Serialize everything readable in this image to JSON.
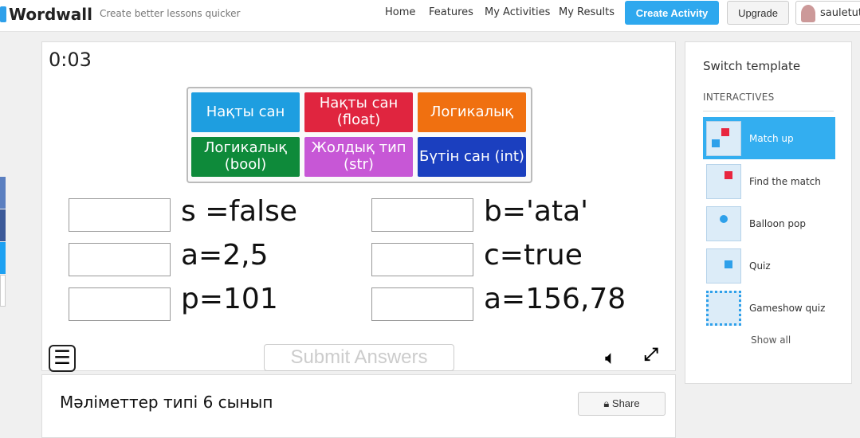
{
  "header": {
    "logo": "Wordwall",
    "tagline": "Create better lessons quicker",
    "nav": [
      "Home",
      "Features",
      "My Activities",
      "My Results"
    ],
    "create": "Create Activity",
    "upgrade": "Upgrade",
    "user": "sauletut"
  },
  "game": {
    "timer": "0:03",
    "tiles": [
      {
        "label": "Нақты сан",
        "color": "#1e9ee0"
      },
      {
        "label": "Нақты сан (float)",
        "color": "#e0253f"
      },
      {
        "label": "Логикалық",
        "color": "#f07010"
      },
      {
        "label": "Логикалық (bool)",
        "color": "#0e8a3a"
      },
      {
        "label": "Жолдық тип (str)",
        "color": "#c757d6"
      },
      {
        "label": "Бүтін сан (int)",
        "color": "#1b3fbf"
      }
    ],
    "items": [
      "s =false",
      "b='ata'",
      "a=2,5",
      "c=true",
      "p=101",
      "a=156,78"
    ],
    "submit": "Submit Answers"
  },
  "info": {
    "title": "Мәліметтер типі 6 сынып",
    "share": "Share"
  },
  "sidebar": {
    "title": "Switch template",
    "section": "INTERACTIVES",
    "templates": [
      "Match up",
      "Find the match",
      "Balloon pop",
      "Quiz",
      "Gameshow quiz"
    ],
    "selected": "Match up",
    "show_all": "Show all"
  }
}
